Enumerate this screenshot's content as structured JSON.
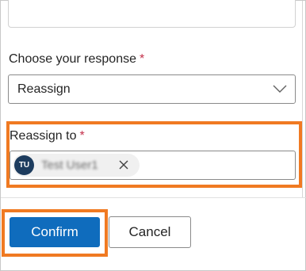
{
  "form": {
    "response_label": "Choose your response",
    "required_marker": "*",
    "response_value": "Reassign",
    "reassign_label": "Reassign to",
    "assignee": {
      "initials": "TU",
      "name": "Test User1"
    }
  },
  "actions": {
    "confirm_label": "Confirm",
    "cancel_label": "Cancel"
  },
  "colors": {
    "highlight": "#f07a22",
    "primary": "#0f6cbd",
    "required": "#c4314b",
    "avatar": "#1d3c5e"
  },
  "icons": {
    "select_chevron": "chevron-down-icon",
    "remove_person": "close-icon"
  }
}
